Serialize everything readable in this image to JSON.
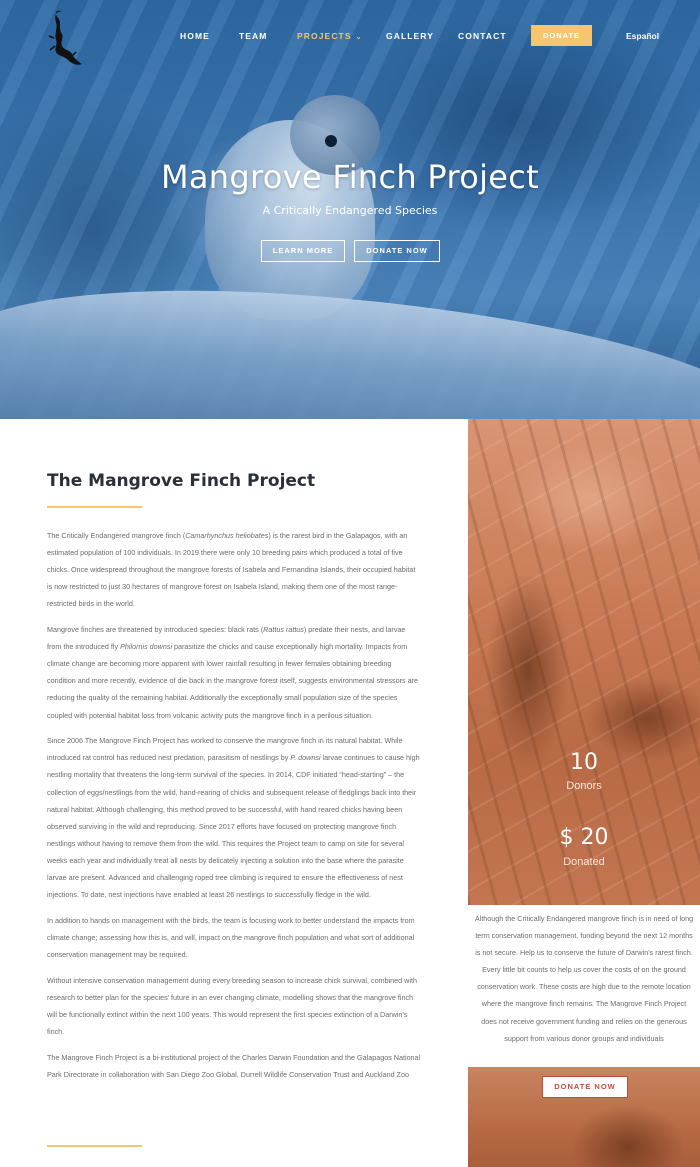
{
  "nav": {
    "items": [
      {
        "label": "HOME"
      },
      {
        "label": "TEAM"
      },
      {
        "label": "PROJECTS"
      },
      {
        "label": "GALLERY"
      },
      {
        "label": "CONTACT"
      }
    ],
    "donate_label": "DONATE",
    "language_label": "Español",
    "active_item": "PROJECTS",
    "accent_color": "#f7c46f"
  },
  "hero": {
    "title": "Mangrove Finch Project",
    "subtitle": "A Critically Endangered Species",
    "learn_more_label": "LEARN MORE",
    "donate_now_label": "DONATE NOW"
  },
  "main": {
    "section_title": "The Mangrove Finch Project",
    "paragraphs": [
      {
        "a": "The Critically Endangered mangrove finch (",
        "em": "Camarhynchus heliobates",
        "b": ") is the rarest bird in the Galapagos, with an estimated population of 100 individuals. In 2019 there were only 10 breeding pairs which produced a total of five chicks. Once widespread throughout the mangrove forests of Isabela and Fernandina Islands, their occupied habitat is now restricted to just 30 hectares of mangrove forest on Isabela Island, making them one of the most range-restricted birds in the world."
      },
      {
        "a": "Mangrove finches are threatened by introduced species: black rats (",
        "em": "Rattus rattus",
        "b": ") predate their nests, and larvae from the introduced fly ",
        "em2": "Philornis downsi",
        "c": " parasitize the chicks and cause exceptionally high mortality. Impacts from climate change are becoming more apparent with lower rainfall resulting in fewer females obtaining breeding condition and more recently, evidence of die back in the mangrove forest itself, suggests environmental stressors are reducing the quality of the remaining habitat. Additionally the exceptionally small population size of the species coupled with potential habitat loss from volcanic activity puts the mangrove finch in a perilous situation."
      },
      {
        "a": "Since 2006 The Mangrove Finch Project has worked to conserve the mangrove finch in its natural habitat. While introduced rat control has reduced nest predation, parasitism of nestlings by ",
        "em": "P. downsi",
        "b": " larvae continues to cause high nestling mortality that threatens the long-term survival of the species. In 2014, CDF initiated “head-starting” – the collection of eggs/nestlings from the wild, hand-rearing of chicks and subsequent release of fledglings back into their natural habitat. Although challenging, this method proved to be successful, with hand reared chicks having been observed surviving in the wild and reproducing. Since 2017 efforts have focused on protecting mangrove finch nestlings without having to remove them from the wild. This requires the Project team to camp on site for several weeks each year and individually treat all nests by delicately injecting a solution into the base where the parasite larvae are present. Advanced and challenging roped tree climbing is required to ensure the effectiveness of nest injections.  To date, nest injections have enabled at least 26 nestlings to successfully fledge in the wild."
      },
      {
        "a": "In addition to hands on management with the birds, the team is focusing work to better understand the impacts from climate change; assessing how this is, and will, impact on the mangrove finch population and what sort of additional conservation management may be required."
      },
      {
        "a": "Without intensive conservation management during every breeding season to increase chick survival, combined with research to better plan for the species’ future in an ever changing climate, modelling shows that the mangrove finch will be functionally extinct within the next 100 years. This would represent the first species extinction of a Darwin’s finch."
      },
      {
        "a": "The Mangrove Finch Project is a bi-institutional project of the Charles Darwin Foundation and the Galapagos National Park Directorate in collaboration with San Diego Zoo Global, Durrell Wildlife Conservation Trust and Auckland Zoo"
      }
    ]
  },
  "sidebar": {
    "donors_count": "10",
    "donors_label": "Donors",
    "currency_symbol": "$",
    "donated_amount": "20",
    "donated_label": "Donated",
    "appeal_text": "Although the Critically Endangered mangrove finch is in need of long term conservation management, funding beyond the next 12 months is not secure. Help us to conserve the future of Darwin’s rarest finch. Every little bit counts to help us cover the costs of on the ground conservation work. These costs are high due to the remote location where the mangrove finch remains. The Mangrove Finch Project does not receive government funding and relies on the generous support from various donor groups and individuals",
    "donate_now_label": "DONATE NOW",
    "donate_color": "#c44a3a"
  }
}
